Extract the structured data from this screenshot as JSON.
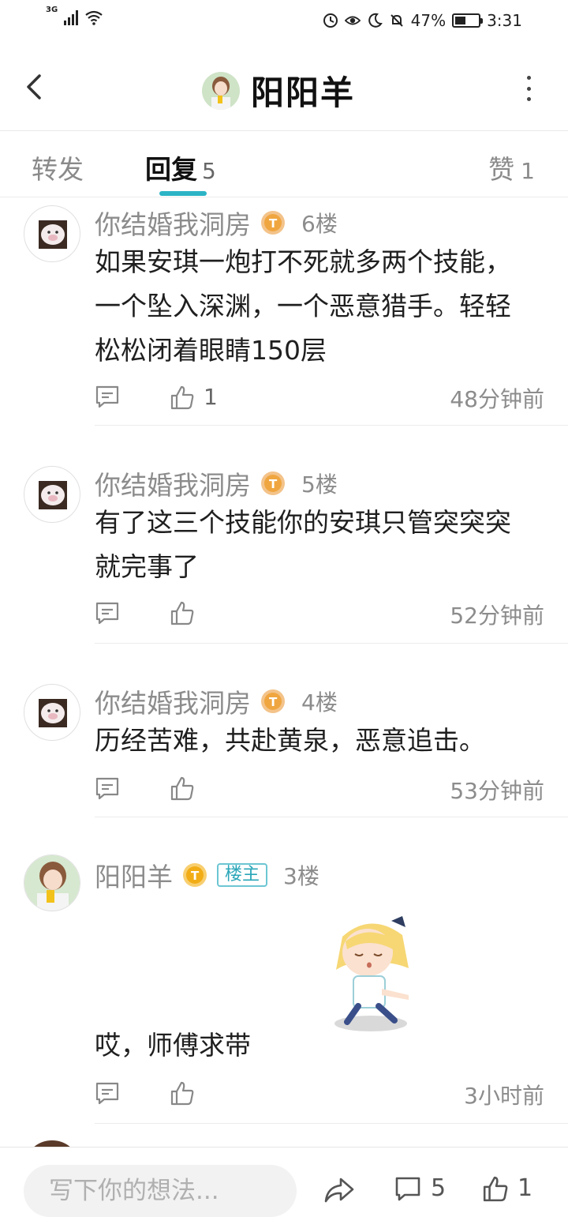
{
  "status_bar": {
    "network": "3G",
    "battery_percent": "47%",
    "battery_level": 0.47,
    "time": "3:31"
  },
  "header": {
    "title": "阳阳羊",
    "back_icon": "chevron-left-icon",
    "more_icon": "more-vertical-icon"
  },
  "tabs": {
    "forward": {
      "label": "转发"
    },
    "reply": {
      "label": "回复",
      "count": "5"
    },
    "like": {
      "label": "赞",
      "count": "1"
    }
  },
  "comments": [
    {
      "user": "你结婚我洞房",
      "floor": "6楼",
      "text": "如果安琪一炮打不死就多两个技能，一个坠入深渊，一个恶意猎手。轻轻松松闭着眼睛150层",
      "likes": "1",
      "time": "48分钟前"
    },
    {
      "user": "你结婚我洞房",
      "floor": "5楼",
      "text": "有了这三个技能你的安琪只管突突突就完事了",
      "likes": "",
      "time": "52分钟前"
    },
    {
      "user": "你结婚我洞房",
      "floor": "4楼",
      "text": "历经苦难，共赴黄泉，恶意追击。",
      "likes": "",
      "time": "53分钟前"
    },
    {
      "user": "阳阳羊",
      "tag": "楼主",
      "floor": "3楼",
      "text": "哎，师傅求带",
      "likes": "",
      "time": "3小时前"
    }
  ],
  "bottom_bar": {
    "input_placeholder": "写下你的想法...",
    "comment_count": "5",
    "like_count": "1"
  },
  "colors": {
    "accent": "#2cb4c6",
    "badge_gold": "#f0a640",
    "muted_text": "#8c8c8c"
  }
}
